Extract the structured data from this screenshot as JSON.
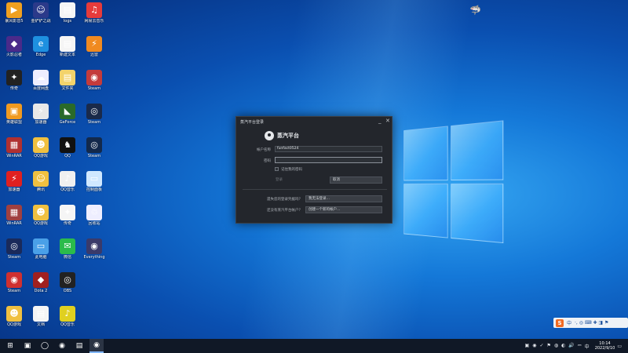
{
  "desktop": {
    "icons": [
      {
        "label": "暴风影音5",
        "glyph": "▶",
        "color": "#f0a020",
        "col": 0,
        "row": 0
      },
      {
        "label": "金铲铲之战",
        "glyph": "☺",
        "color": "#2b3a8a",
        "col": 1,
        "row": 0
      },
      {
        "label": "logs",
        "glyph": "▤",
        "color": "#f5f5f5",
        "col": 2,
        "row": 0
      },
      {
        "label": "网易云音乐",
        "glyph": "♫",
        "color": "#e63b3b",
        "col": 3,
        "row": 0
      },
      {
        "label": "火影忍者",
        "glyph": "◆",
        "color": "#4a2a8a",
        "col": 0,
        "row": 1
      },
      {
        "label": "Edge",
        "glyph": "e",
        "color": "#1e90e0",
        "col": 1,
        "row": 1
      },
      {
        "label": "新建文本",
        "glyph": "▤",
        "color": "#f5f5f5",
        "col": 2,
        "row": 1
      },
      {
        "label": "迅雷",
        "glyph": "⚡",
        "color": "#f08a20",
        "col": 3,
        "row": 1
      },
      {
        "label": "传奇",
        "glyph": "✦",
        "color": "#222",
        "col": 0,
        "row": 2
      },
      {
        "label": "百度网盘",
        "glyph": "☁",
        "color": "#eef",
        "col": 1,
        "row": 2
      },
      {
        "label": "文件夹",
        "glyph": "▤",
        "color": "#f3d36b",
        "col": 2,
        "row": 2
      },
      {
        "label": "Steam",
        "glyph": "◉",
        "color": "#c43b3b",
        "col": 3,
        "row": 2
      },
      {
        "label": "英雄联盟",
        "glyph": "▣",
        "color": "#f09a20",
        "col": 0,
        "row": 3
      },
      {
        "label": "加速器",
        "glyph": "⚡",
        "color": "#e8e8e8",
        "col": 1,
        "row": 3
      },
      {
        "label": "GeForce",
        "glyph": "◣",
        "color": "#2a6a2a",
        "col": 2,
        "row": 3
      },
      {
        "label": "Steam",
        "glyph": "◎",
        "color": "#1a2a4a",
        "col": 3,
        "row": 3
      },
      {
        "label": "WinRAR",
        "glyph": "▦",
        "color": "#b03030",
        "col": 0,
        "row": 4
      },
      {
        "label": "QQ游戏",
        "glyph": "☻",
        "color": "#f0c040",
        "col": 1,
        "row": 4
      },
      {
        "label": "QQ",
        "glyph": "♞",
        "color": "#111",
        "col": 2,
        "row": 4
      },
      {
        "label": "Steam",
        "glyph": "◎",
        "color": "#13294b",
        "col": 3,
        "row": 4
      },
      {
        "label": "加速器",
        "glyph": "⚡",
        "color": "#e02020",
        "col": 0,
        "row": 5
      },
      {
        "label": "腾讯",
        "glyph": "☺",
        "color": "#f0c040",
        "col": 1,
        "row": 5
      },
      {
        "label": "QQ音乐",
        "glyph": "♪",
        "color": "#f0f0f0",
        "col": 2,
        "row": 5
      },
      {
        "label": "控制面板",
        "glyph": "▭",
        "color": "#d0e8ff",
        "col": 3,
        "row": 5
      },
      {
        "label": "WinRAR",
        "glyph": "▦",
        "color": "#a04040",
        "col": 0,
        "row": 6
      },
      {
        "label": "QQ游戏",
        "glyph": "☻",
        "color": "#f0c040",
        "col": 1,
        "row": 6
      },
      {
        "label": "传奇",
        "glyph": "✦",
        "color": "#f5f5f5",
        "col": 2,
        "row": 6
      },
      {
        "label": "回收站",
        "glyph": "♲",
        "color": "#eef",
        "col": 3,
        "row": 6
      },
      {
        "label": "Steam",
        "glyph": "◎",
        "color": "#1a2a5a",
        "col": 0,
        "row": 7
      },
      {
        "label": "此电脑",
        "glyph": "▭",
        "color": "#4aa0e8",
        "col": 1,
        "row": 7
      },
      {
        "label": "微信",
        "glyph": "✉",
        "color": "#2bbb4b",
        "col": 2,
        "row": 7
      },
      {
        "label": "Everything",
        "glyph": "◉",
        "color": "#3a3a6a",
        "col": 3,
        "row": 7
      },
      {
        "label": "Steam",
        "glyph": "◉",
        "color": "#d03030",
        "col": 0,
        "row": 8
      },
      {
        "label": "Dota 2",
        "glyph": "◆",
        "color": "#a02020",
        "col": 1,
        "row": 8
      },
      {
        "label": "OBS",
        "glyph": "◎",
        "color": "#222",
        "col": 2,
        "row": 8
      },
      {
        "label": "QQ游戏",
        "glyph": "☻",
        "color": "#f0c040",
        "col": 0,
        "row": 9
      },
      {
        "label": "文档",
        "glyph": "▤",
        "color": "#f5f5f5",
        "col": 1,
        "row": 9
      },
      {
        "label": "QQ音乐",
        "glyph": "♪",
        "color": "#e0d020",
        "col": 2,
        "row": 9
      }
    ]
  },
  "dialog": {
    "title": "蒸汽平台登录",
    "minimize": "_",
    "close": "✕",
    "brand": "蒸汽平台",
    "account_label": "帐户名称",
    "account_value": "funfact0524",
    "password_label": "密码",
    "password_value": "",
    "remember_label": "记住我的密码",
    "login_button": "登录",
    "cancel_button": "取消",
    "forgot_question": "遗失您的登录凭据吗？",
    "forgot_button": "我无法登录…",
    "create_question": "还没有蒸汽平台帐户？",
    "create_button": "创建一个新的帐户…"
  },
  "ime": {
    "logo": "S",
    "mode": "中",
    "extra": "·,  ◎  ⌨  ✚  ◨  ⚑"
  },
  "taskbar": {
    "start": "⊞",
    "apps": [
      {
        "name": "task-view",
        "glyph": "▣"
      },
      {
        "name": "search",
        "glyph": "◯"
      },
      {
        "name": "chrome",
        "glyph": "◉"
      },
      {
        "name": "file-explorer",
        "glyph": "▤"
      },
      {
        "name": "steam-app",
        "glyph": "◉"
      }
    ],
    "tray_icons": [
      "▣",
      "◉",
      "✓",
      "⚑",
      "◍",
      "◐",
      "🔊",
      "⎓",
      "中"
    ],
    "time": "10:14",
    "date": "2022/9/10",
    "notify": "▭"
  }
}
